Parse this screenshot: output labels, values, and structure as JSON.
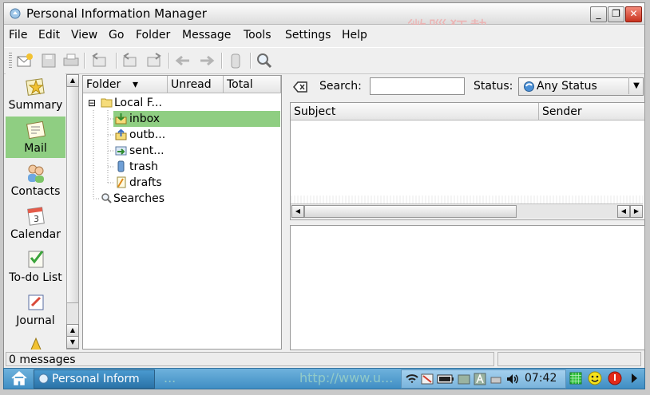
{
  "window": {
    "title": "Personal Information Manager",
    "watermark_title": "微腦狂熱",
    "accent_color": "#8fce82",
    "controls": {
      "minimize": "_",
      "maximize": "❐",
      "close": "✕"
    }
  },
  "menubar": [
    "File",
    "Edit",
    "View",
    "Go",
    "Folder",
    "Message",
    "Tools",
    "Settings",
    "Help"
  ],
  "toolbar": {
    "icons": [
      "new-message-icon",
      "save-icon",
      "print-icon",
      "reply-icon",
      "reply-all-icon",
      "forward-icon",
      "back-arrow-icon",
      "forward-arrow-icon",
      "delete-icon",
      "find-icon"
    ]
  },
  "sidebar": {
    "items": [
      {
        "label": "Summary",
        "icon": "summary-icon",
        "selected": false
      },
      {
        "label": "Mail",
        "icon": "mail-icon",
        "selected": true
      },
      {
        "label": "Contacts",
        "icon": "contacts-icon",
        "selected": false
      },
      {
        "label": "Calendar",
        "icon": "calendar-icon",
        "selected": false,
        "day": "3"
      },
      {
        "label": "To-do List",
        "icon": "todo-icon",
        "selected": false
      },
      {
        "label": "Journal",
        "icon": "journal-icon",
        "selected": false
      }
    ]
  },
  "folders": {
    "columns": [
      "Folder",
      "Unread",
      "Total"
    ],
    "sort_indicator": "▾",
    "root": {
      "label": "Local F...",
      "expand": "⊟"
    },
    "items": [
      {
        "label": "inbox",
        "icon": "inbox-icon",
        "selected": true
      },
      {
        "label": "outb...",
        "icon": "outbox-icon",
        "selected": false
      },
      {
        "label": "sent...",
        "icon": "sent-icon",
        "selected": false
      },
      {
        "label": "trash",
        "icon": "trash-icon",
        "selected": false
      },
      {
        "label": "drafts",
        "icon": "drafts-icon",
        "selected": false
      }
    ],
    "searches": "Searches"
  },
  "search": {
    "label": "Search:",
    "value": "",
    "status_label": "Status:",
    "status_value": "Any Status"
  },
  "message_list": {
    "columns": [
      "Subject",
      "Sender"
    ],
    "rows": []
  },
  "statusbar": {
    "message_count": "0 messages"
  },
  "taskbar": {
    "task_label": "Personal Inform",
    "watermark_url": "http://www.u...",
    "watermark_left": "...",
    "clock": "07:42",
    "tray_icons": [
      "wifi-icon",
      "network-icon",
      "battery-icon",
      "keyboard-icon",
      "font-icon",
      "printer-icon",
      "volume-icon"
    ],
    "right_icons": [
      "desktop-grid-icon",
      "smiley-icon",
      "power-icon",
      "arrow-right-icon"
    ]
  }
}
